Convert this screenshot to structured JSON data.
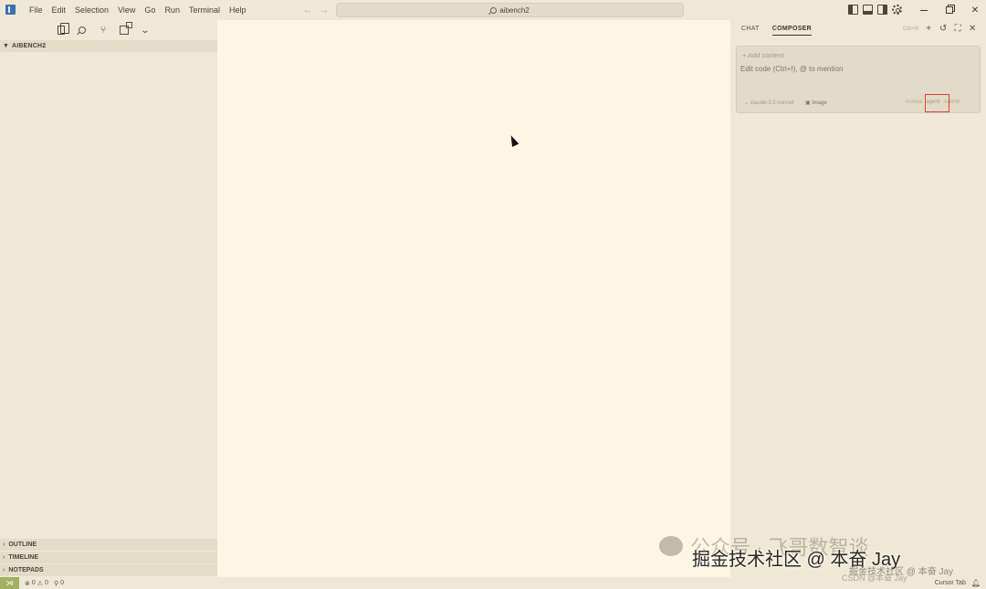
{
  "titlebar": {
    "menu": [
      "File",
      "Edit",
      "Selection",
      "View",
      "Go",
      "Run",
      "Terminal",
      "Help"
    ],
    "nav_back": "←",
    "nav_forward": "→",
    "search_text": "aibench2"
  },
  "sidebar": {
    "explorer_title": "AIBENCH2",
    "panels": [
      "OUTLINE",
      "TIMELINE",
      "NOTEPADS"
    ]
  },
  "right_panel": {
    "tabs": [
      "CHAT",
      "COMPOSER"
    ],
    "active_tab": "COMPOSER",
    "shortcut": "Ctrl+N",
    "add_context": "+ Add context",
    "input_placeholder": "Edit code (Ctrl+I), @ to mention",
    "model": "⌄ claude-3.5-sonnet",
    "image_label": "image",
    "modes": [
      "normal",
      "agent",
      "submit"
    ]
  },
  "statusbar": {
    "remote": "⋊",
    "errors": "0",
    "warnings": "0",
    "ports": "0",
    "cursor_tab": "Cursor Tab"
  },
  "watermarks": {
    "wechat": "公众号 · 飞哥数智谈",
    "juejin": "掘金技术社区 @ 本奋 Jay",
    "small1": "掘金技术社区 @ 本奋 Jay",
    "csdn": "CSDN @本奋 Jay"
  }
}
